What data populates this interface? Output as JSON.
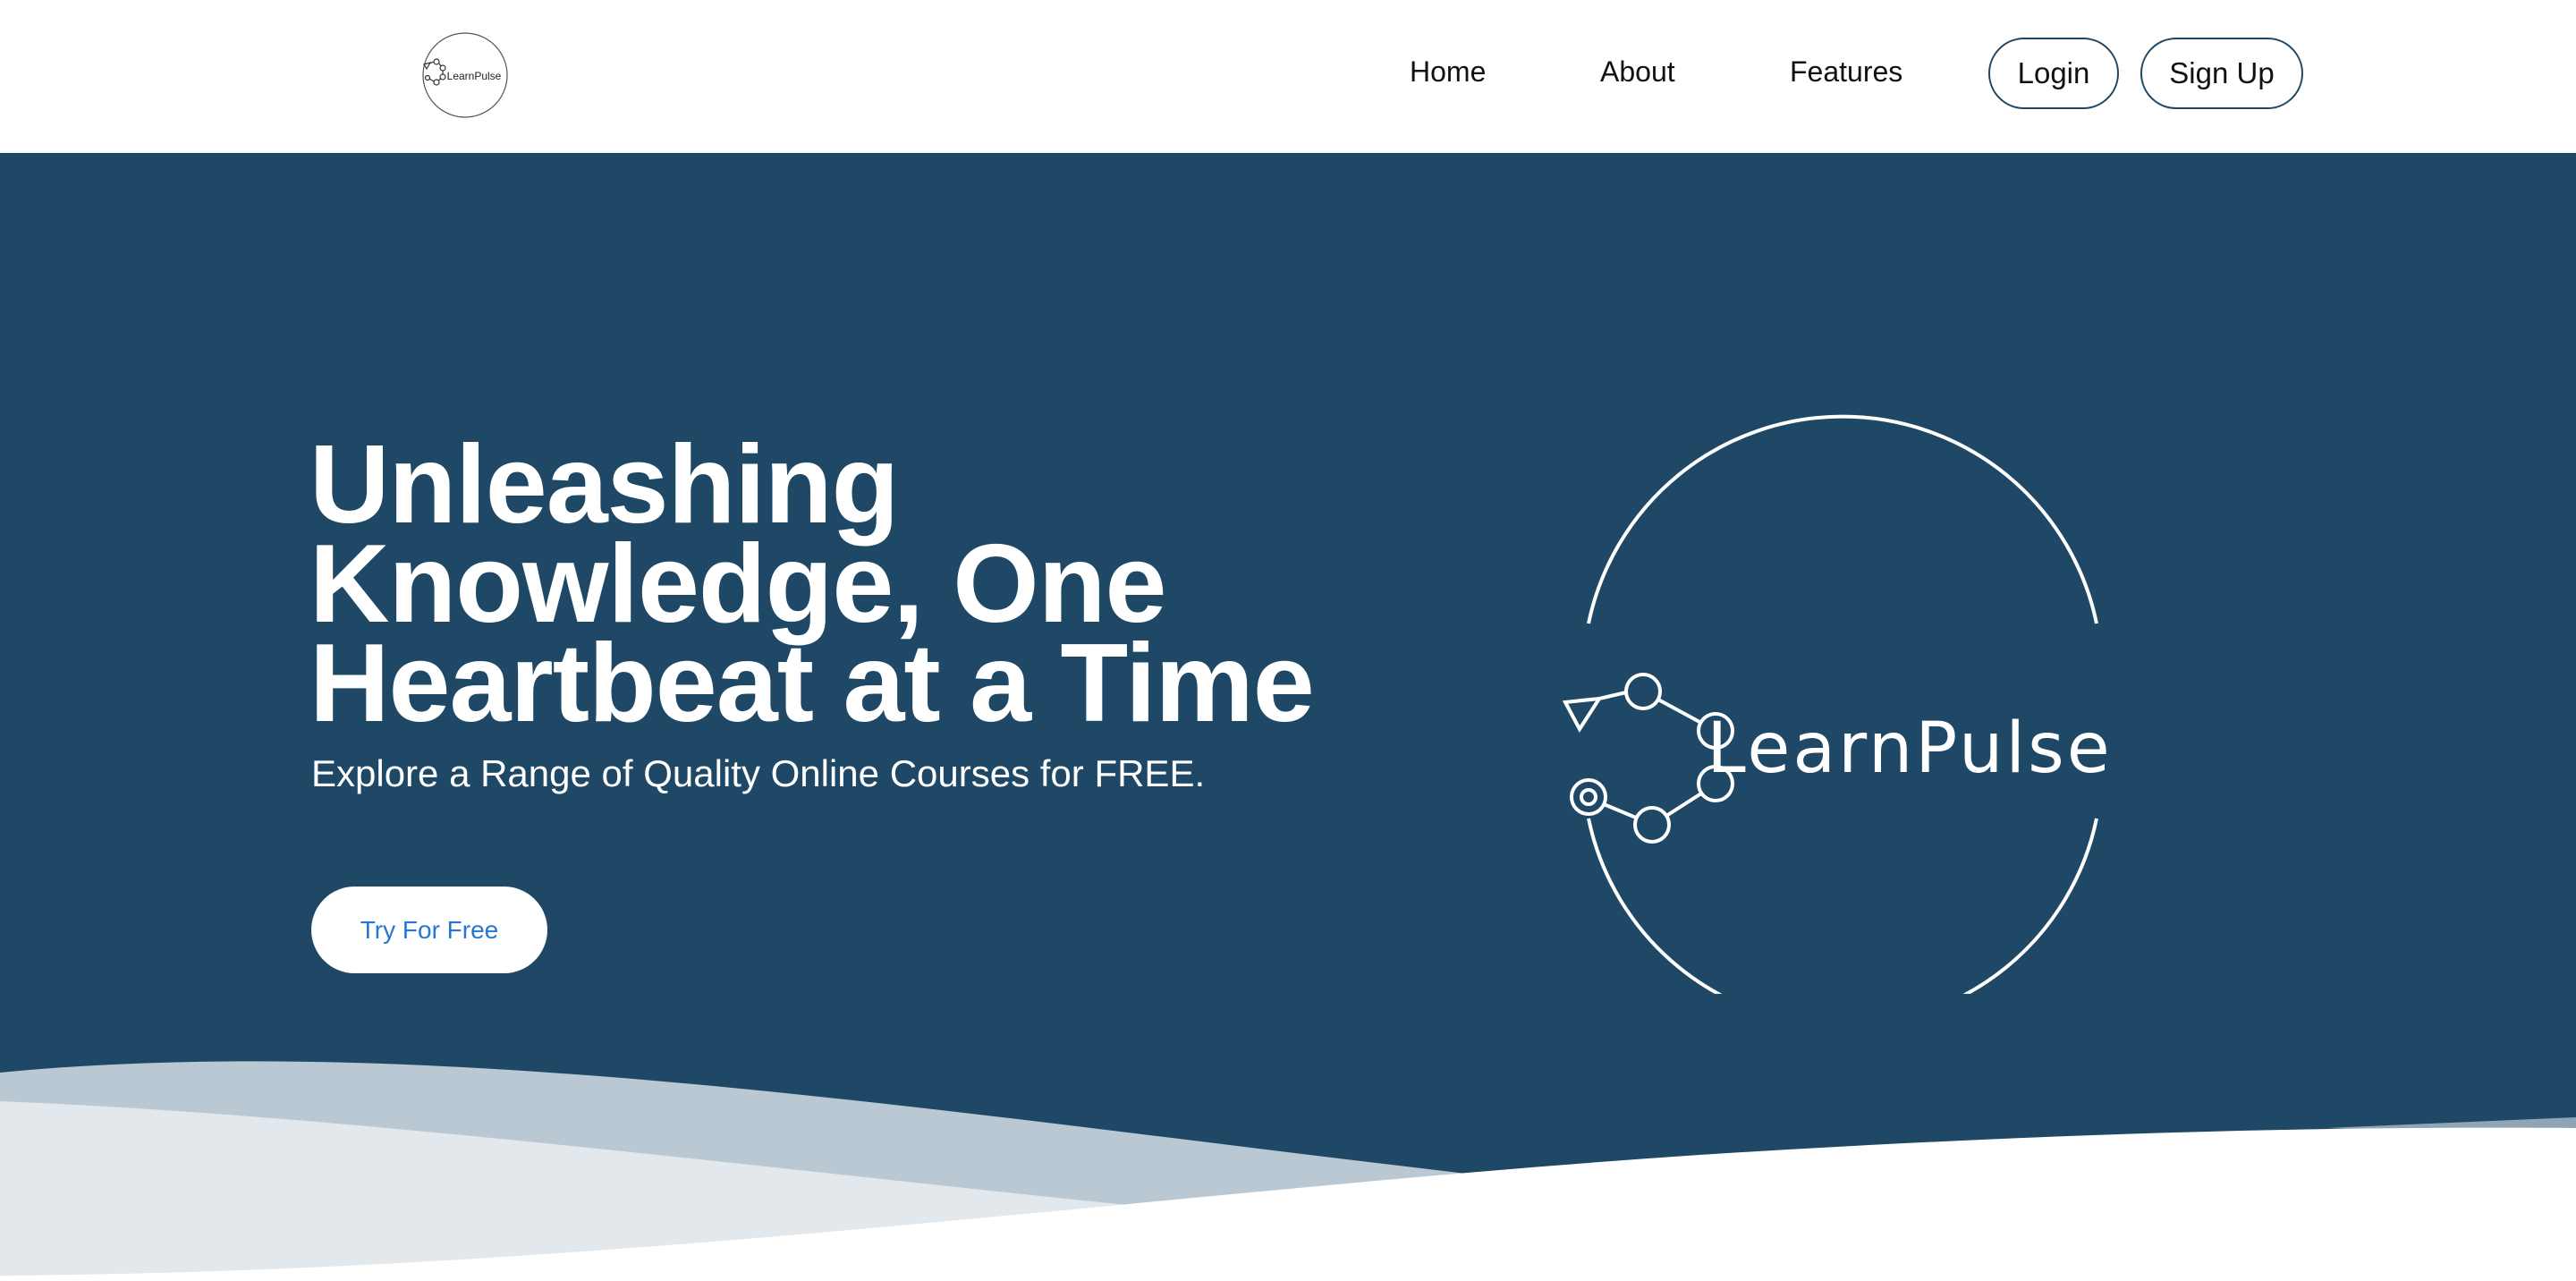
{
  "header": {
    "logo_text": "LearnPulse",
    "nav": [
      {
        "label": "Home"
      },
      {
        "label": "About"
      },
      {
        "label": "Features"
      }
    ],
    "login_label": "Login",
    "signup_label": "Sign Up"
  },
  "hero": {
    "title": "Unleashing Knowledge, One Heartbeat at a Time",
    "subtitle": "Explore a Range of Quality Online Courses for FREE.",
    "cta_label": "Try For Free",
    "logo_text": "LearnPulse"
  },
  "colors": {
    "hero_bg": "#1e4865",
    "cta_text": "#2577d6",
    "border": "#1d4763",
    "wave_light": "#e2e8ec",
    "wave_mid": "#b9c8d3"
  },
  "icons": [
    "learnpulse-logo-icon"
  ]
}
